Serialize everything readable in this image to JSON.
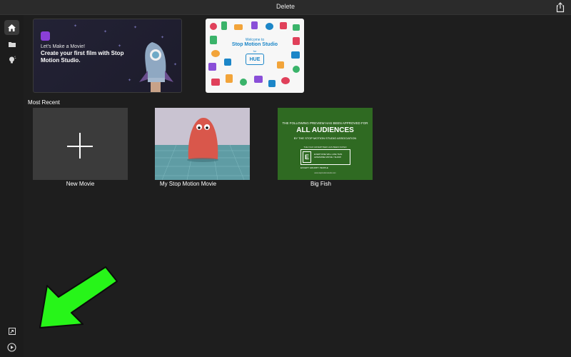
{
  "topbar": {
    "title": "Delete",
    "share_icon": "share-icon"
  },
  "sidebar": {
    "items": [
      {
        "icon": "home-icon",
        "active": true
      },
      {
        "icon": "folder-icon",
        "active": false
      },
      {
        "icon": "lightbulb-icon",
        "active": false
      }
    ],
    "bottom_items": [
      {
        "icon": "import-icon"
      },
      {
        "icon": "play-circle-icon"
      }
    ]
  },
  "banners": {
    "make_movie": {
      "subtitle": "Let's Make a Movie!",
      "title": "Create your first film with Stop Motion Studio."
    },
    "hue": {
      "welcome": "Welcome to",
      "title": "Stop Motion Studio",
      "for": "for",
      "logo": "HUE"
    }
  },
  "recent": {
    "heading": "Most Recent",
    "tiles": [
      {
        "label": "New Movie"
      },
      {
        "label": "My Stop Motion Movie"
      },
      {
        "label": "Big Fish"
      }
    ]
  },
  "big_fish_thumbnail": {
    "top_line": "THE FOLLOWING PREVIEW HAS BEEN APPROVED FOR",
    "big_line": "ALL AUDIENCES",
    "assoc_line": "BY THE STOP MOTION STUDIO ASSOCIATION",
    "film_line": "THE FILM ADVERTISED HAS BEEN RATED",
    "rating_letter": "E",
    "rating_desc": "EVERYONE WILL LIKE THIS AWESOME MOVIE / SHOW",
    "rating_note": "EXCEPT GRUMPY PEOPLE",
    "url": "www.stopmotionstudio.com"
  },
  "colors": {
    "background": "#1e1e1e",
    "topbar": "#2b2b2b",
    "accent_purple": "#8a3fd8",
    "hue_blue": "#1c86c8",
    "rating_green": "#2f6a22",
    "annotation_arrow": "#27f519"
  }
}
